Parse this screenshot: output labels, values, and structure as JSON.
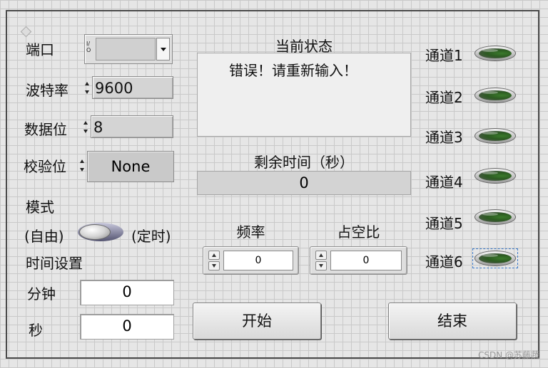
{
  "serial": {
    "port_label": "端口",
    "port_value": "",
    "port_icon_text": "I/O",
    "baud_label": "波特率",
    "baud_value": "9600",
    "databits_label": "数据位",
    "databits_value": "8",
    "parity_label": "校验位",
    "parity_value": "None"
  },
  "mode": {
    "label": "模式",
    "left_label": "(自由)",
    "right_label": "(定时)",
    "state": "自由"
  },
  "time_setting": {
    "label": "时间设置",
    "minutes_label": "分钟",
    "minutes_value": "0",
    "seconds_label": "秒",
    "seconds_value": "0"
  },
  "status": {
    "title": "当前状态",
    "message": "错误！请重新输入！",
    "remaining_label": "剩余时间（秒）",
    "remaining_value": "0"
  },
  "pwm": {
    "freq_label": "频率",
    "freq_value": "0",
    "duty_label": "占空比",
    "duty_value": "0"
  },
  "buttons": {
    "start": "开始",
    "stop": "结束"
  },
  "channels": [
    {
      "label": "通道1"
    },
    {
      "label": "通道2"
    },
    {
      "label": "通道3"
    },
    {
      "label": "通道4"
    },
    {
      "label": "通道5"
    },
    {
      "label": "通道6"
    }
  ],
  "watermark": "CSDN @苏藤蔬",
  "colors": {
    "led_green": "#2c5a21",
    "panel_bg": "#e6e6e6",
    "grid": "#c9c9c9"
  }
}
